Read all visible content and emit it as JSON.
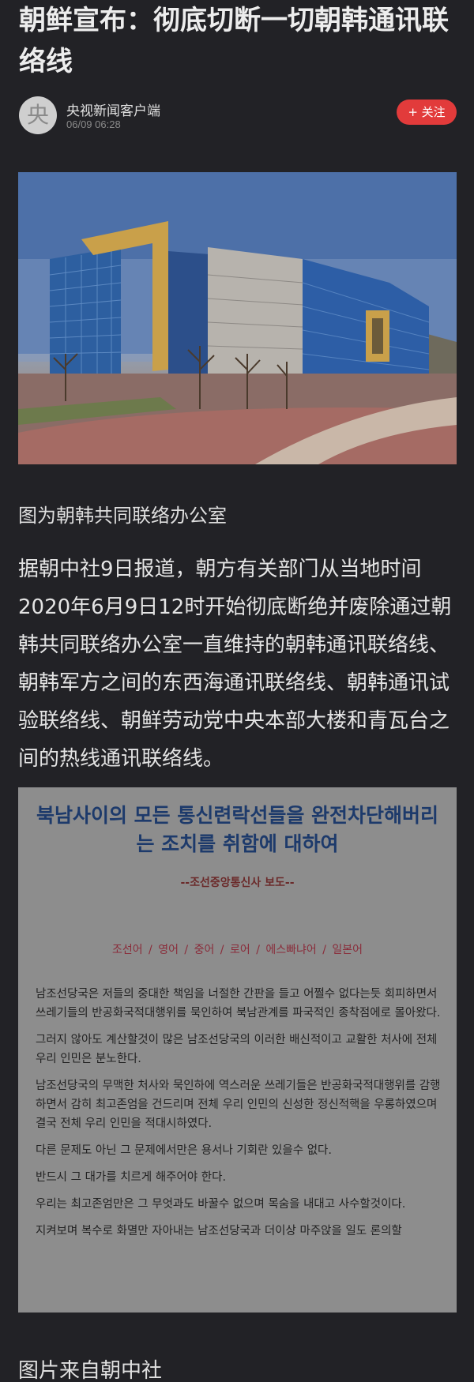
{
  "article": {
    "title": "朝鲜宣布：彻底切断一切朝韩通讯联络线"
  },
  "author": {
    "avatar_char": "央",
    "name": "央视新闻客户端",
    "time": "06/09 06:28",
    "follow_label": "+ 关注"
  },
  "photo": {
    "caption": "图为朝韩共同联络办公室"
  },
  "body": {
    "paragraph": "据朝中社9日报道，朝方有关部门从当地时间2020年6月9日12时开始彻底断绝并废除通过朝韩共同联络办公室一直维持的朝韩通讯联络线、朝韩军方之间的东西海通讯联络线、朝韩通讯试验联络线、朝鲜劳动党中央本部大楼和青瓦台之间的热线通讯联络线。"
  },
  "document": {
    "title": "북남사이의 모든 통신련락선들을 완전차단해버리는 조치를 취함에 대하여",
    "subtitle": "--조선중앙통신사 보도--",
    "languages": [
      "조선어",
      "영어",
      "중어",
      "로어",
      "에스빠냐어",
      "일본어"
    ],
    "paragraphs": [
      "남조선당국은 저들의 중대한 책임을 너절한 간판을 들고 어쩔수 없다는듯 회피하면서 쓰레기들의 반공화국적대행위를 묵인하여 북남관계를 파국적인 종착점에로 몰아왔다.",
      "그러지 않아도 계산할것이 많은 남조선당국의 이러한 배신적이고 교활한 처사에 전체 우리 인민은 분노한다.",
      "남조선당국의 무맥한 처사와 묵인하에 역스러운 쓰레기들은 반공화국적대행위를 감행하면서 감히 최고존엄을 건드리며 전체 우리 인민의 신성한 정신적핵을 우롱하였으며 결국 전체 우리 인민을 적대시하였다.",
      "다른 문제도 아닌 그 문제에서만은 용서나 기회란 있을수 없다.",
      "반드시 그 대가를 치르게 해주어야 한다.",
      "우리는 최고존엄만은 그 무엇과도 바꿀수 없으며 목숨을 내대고 사수할것이다.",
      "지켜보며 복수로 화멸만 자아내는 남조선당국과 더이상 마주앉을 일도 론의할"
    ]
  },
  "source": {
    "text": "图片来自朝中社"
  }
}
